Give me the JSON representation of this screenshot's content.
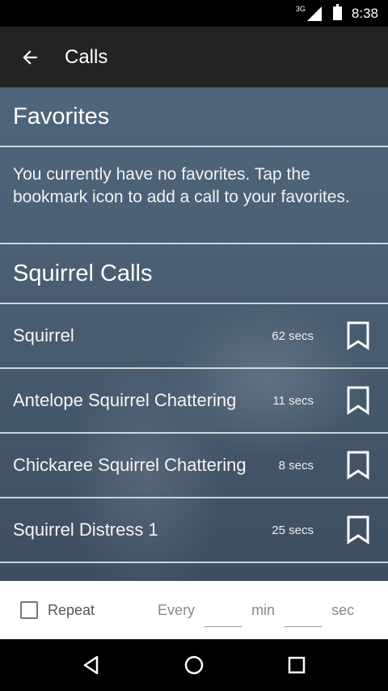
{
  "status_bar": {
    "network": "3G",
    "time": "8:38"
  },
  "app_bar": {
    "title": "Calls",
    "back_icon": "arrow-left-icon"
  },
  "favorites": {
    "header": "Favorites",
    "empty_message": "You currently have no favorites. Tap the bookmark icon to add a call to your favorites."
  },
  "squirrel_calls": {
    "header": "Squirrel Calls",
    "items": [
      {
        "name": "Squirrel",
        "duration": "62 secs"
      },
      {
        "name": "Antelope Squirrel Chattering",
        "duration": "11 secs"
      },
      {
        "name": "Chickaree Squirrel Chattering",
        "duration": "8 secs"
      },
      {
        "name": "Squirrel Distress 1",
        "duration": "25 secs"
      }
    ]
  },
  "controls": {
    "repeat_label": "Repeat",
    "every_label": "Every",
    "min_label": "min",
    "sec_label": "sec",
    "min_value": "",
    "sec_value": ""
  },
  "nav_bar": {
    "back_icon": "triangle-back-icon",
    "home_icon": "circle-home-icon",
    "recents_icon": "square-recents-icon"
  },
  "colors": {
    "app_bar": "#232323",
    "content_bg": "#4a5d72",
    "controls_bg": "#ffffff"
  }
}
